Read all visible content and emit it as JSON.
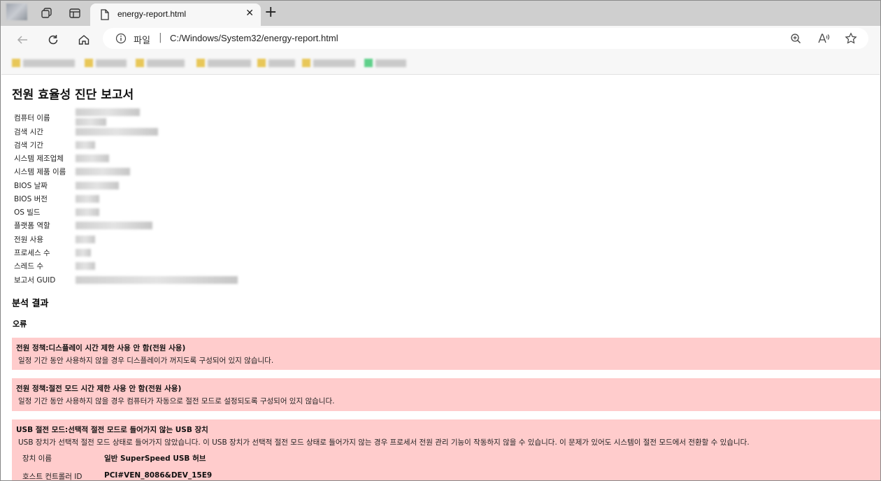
{
  "browser": {
    "tab_title": "energy-report.html",
    "address_scheme_label": "파일",
    "address_url": "C:/Windows/System32/energy-report.html"
  },
  "report": {
    "title": "전원 효율성 진단 보고서",
    "fields": [
      {
        "label": "컴퓨터 이름"
      },
      {
        "label": "검색 시간"
      },
      {
        "label": "검색 기간"
      },
      {
        "label": "시스템 제조업체"
      },
      {
        "label": "시스템 제품 이름"
      },
      {
        "label": "BIOS 날짜"
      },
      {
        "label": "BIOS 버전"
      },
      {
        "label": "OS 빌드"
      },
      {
        "label": "플랫폼 역할"
      },
      {
        "label": "전원 사용"
      },
      {
        "label": "프로세스 수"
      },
      {
        "label": "스레드 수"
      },
      {
        "label": "보고서 GUID"
      }
    ],
    "analysis_heading": "분석 결과",
    "errors_heading": "오류",
    "errors": [
      {
        "title": "전원 정책:디스플레이 시간 제한 사용 안 함(전원 사용)",
        "description": "일정 기간 동안 사용하지 않을 경우 디스플레이가 꺼지도록 구성되어 있지 않습니다."
      },
      {
        "title": "전원 정책:절전 모드 시간 제한 사용 안 함(전원 사용)",
        "description": "일정 기간 동안 사용하지 않을 경우 컴퓨터가 자동으로 절전 모드로 설정되도록 구성되어 있지 않습니다."
      },
      {
        "title": "USB 절전 모드:선택적 절전 모드로 들어가지 않는 USB 장치",
        "description": "USB 장치가 선택적 절전 모드 상태로 들어가지 않았습니다. 이 USB 장치가 선택적 절전 모드 상태로 들어가지 않는 경우 프로세서 전원 관리 기능이 작동하지 않을 수 있습니다. 이 문제가 있어도 시스템이 절전 모드에서 전환할 수 있습니다.",
        "details": [
          {
            "label": "장치 이름",
            "value": "일반 SuperSpeed USB 허브"
          },
          {
            "label": "호스트 컨트롤러 ID",
            "value": "PCI#VEN_8086&DEV_15E9"
          }
        ]
      }
    ]
  }
}
